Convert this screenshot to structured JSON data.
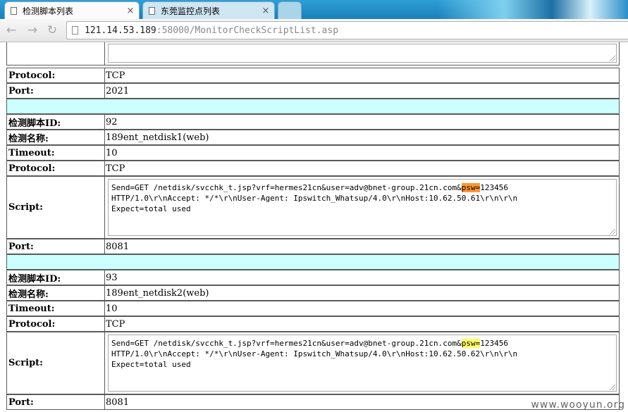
{
  "tabs": [
    {
      "label": "检测脚本列表",
      "close": "×",
      "icon": "page-icon"
    },
    {
      "label": "东莞监控点列表",
      "close": "×",
      "icon": "page-icon"
    }
  ],
  "toolbar": {
    "url_host": "121.14.53.189",
    "url_rest": ":58000/MonitorCheckScriptList.asp"
  },
  "labels": {
    "protocol": "Protocol:",
    "port": "Port:",
    "script_id": "检测脚本ID:",
    "script_name": "检测名称:",
    "timeout": "Timeout:",
    "script": "Script:"
  },
  "record0": {
    "protocol": "TCP",
    "port": "2021"
  },
  "records": [
    {
      "id": "92",
      "name": "189ent_netdisk1(web)",
      "timeout": "10",
      "protocol": "TCP",
      "script_pre": "Send=GET /netdisk/svcchk_t.jsp?vrf=hermes21cn&user=adv@bnet-group.21cn.com&",
      "script_hl": "psw=",
      "script_post": "123456\nHTTP/1.0\\r\\nAccept: */*\\r\\nUser-Agent: Ipswitch_Whatsup/4.0\\r\\nHost:10.62.50.61\\r\\n\\r\\n\nExpect=total used",
      "port": "8081"
    },
    {
      "id": "93",
      "name": "189ent_netdisk2(web)",
      "timeout": "10",
      "protocol": "TCP",
      "script_pre": "Send=GET /netdisk/svcchk_t.jsp?vrf=hermes21cn&user=adv@bnet-group.21cn.com&",
      "script_hl": "psw=",
      "script_post": "123456\nHTTP/1.0\\r\\nAccept: */*\\r\\nUser-Agent: Ipswitch_Whatsup/4.0\\r\\nHost:10.62.50.62\\r\\n\\r\\n\nExpect=total used",
      "port": "8081"
    }
  ],
  "watermark": "www.wooyun.org",
  "colors": {
    "separator": "#ccffff",
    "highlight_current": "#ff9632",
    "highlight_other": "#ffff66"
  }
}
